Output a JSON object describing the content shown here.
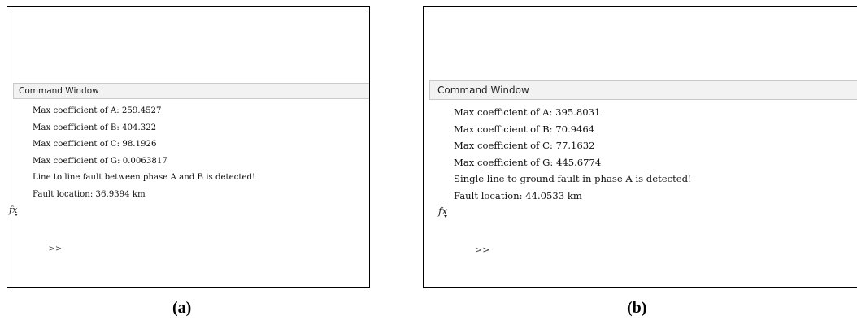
{
  "panels": [
    {
      "window_title": "Command Window",
      "lines": [
        "Max coefficient of A: 259.4527",
        "Max coefficient of B: 404.322",
        "Max coefficient of C: 98.1926",
        "Max coefficient of G: 0.0063817",
        "Line to line fault between phase A and B is detected!",
        "Fault location: 36.9394 km"
      ],
      "prompt_icon": "fx-icon",
      "prompt": ">>",
      "caption": "(a)"
    },
    {
      "window_title": "Command Window",
      "lines": [
        "Max coefficient of A: 395.8031",
        "Max coefficient of B: 70.9464",
        "Max coefficient of C: 77.1632",
        "Max coefficient of G: 445.6774",
        "Single line to ground fault in phase A is detected!",
        "Fault location: 44.0533 km"
      ],
      "prompt_icon": "fx-icon",
      "prompt": ">>",
      "caption": "(b)"
    }
  ],
  "fx_glyph": "fx"
}
